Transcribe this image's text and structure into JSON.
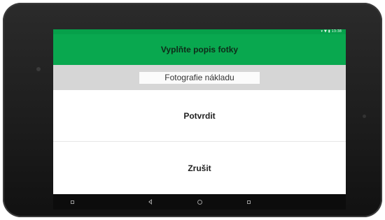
{
  "device": {
    "status_time": "13:38"
  },
  "dialog": {
    "title": "Vyplňte popis fotky",
    "photo_description": {
      "value": "Fotografie nákladu",
      "placeholder": ""
    },
    "confirm_label": "Potvrdit",
    "cancel_label": "Zrušit"
  },
  "colors": {
    "accent": "#09a84f",
    "description_bg": "#d6d6d6",
    "navbar_bg": "#0c0c0c"
  },
  "icons": {
    "status": [
      "signal-icon",
      "wifi-icon",
      "battery-icon"
    ],
    "navigation": [
      "screen-icon",
      "back-icon",
      "home-icon",
      "recents-icon"
    ]
  }
}
